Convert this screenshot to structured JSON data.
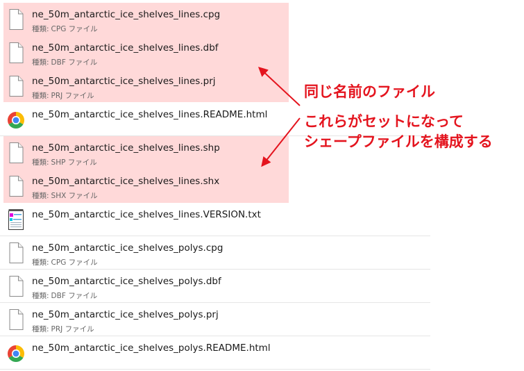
{
  "type_label": "種類:",
  "colors": {
    "highlight": "#ffd9d9",
    "annotation": "#e4141e",
    "separator": "#e6e6e6"
  },
  "files": [
    {
      "name": "ne_50m_antarctic_ice_shelves_lines.cpg",
      "type": "CPG ファイル",
      "icon": "blank-file-icon",
      "highlighted": true
    },
    {
      "name": "ne_50m_antarctic_ice_shelves_lines.dbf",
      "type": "DBF ファイル",
      "icon": "blank-file-icon",
      "highlighted": true
    },
    {
      "name": "ne_50m_antarctic_ice_shelves_lines.prj",
      "type": "PRJ ファイル",
      "icon": "blank-file-icon",
      "highlighted": true
    },
    {
      "name": "ne_50m_antarctic_ice_shelves_lines.README.html",
      "type": "",
      "icon": "chrome-icon",
      "highlighted": false
    },
    {
      "name": "ne_50m_antarctic_ice_shelves_lines.shp",
      "type": "SHP ファイル",
      "icon": "blank-file-icon",
      "highlighted": true
    },
    {
      "name": "ne_50m_antarctic_ice_shelves_lines.shx",
      "type": "SHX ファイル",
      "icon": "blank-file-icon",
      "highlighted": true
    },
    {
      "name": "ne_50m_antarctic_ice_shelves_lines.VERSION.txt",
      "type": "",
      "icon": "notepad-icon",
      "highlighted": false
    },
    {
      "name": "ne_50m_antarctic_ice_shelves_polys.cpg",
      "type": "CPG ファイル",
      "icon": "blank-file-icon",
      "highlighted": false
    },
    {
      "name": "ne_50m_antarctic_ice_shelves_polys.dbf",
      "type": "DBF ファイル",
      "icon": "blank-file-icon",
      "highlighted": false
    },
    {
      "name": "ne_50m_antarctic_ice_shelves_polys.prj",
      "type": "PRJ ファイル",
      "icon": "blank-file-icon",
      "highlighted": false
    },
    {
      "name": "ne_50m_antarctic_ice_shelves_polys.README.html",
      "type": "",
      "icon": "chrome-icon",
      "highlighted": false
    }
  ],
  "annotation": {
    "line1": "同じ名前のファイル",
    "line2": "これらがセットになって",
    "line3": "シェープファイルを構成する"
  }
}
